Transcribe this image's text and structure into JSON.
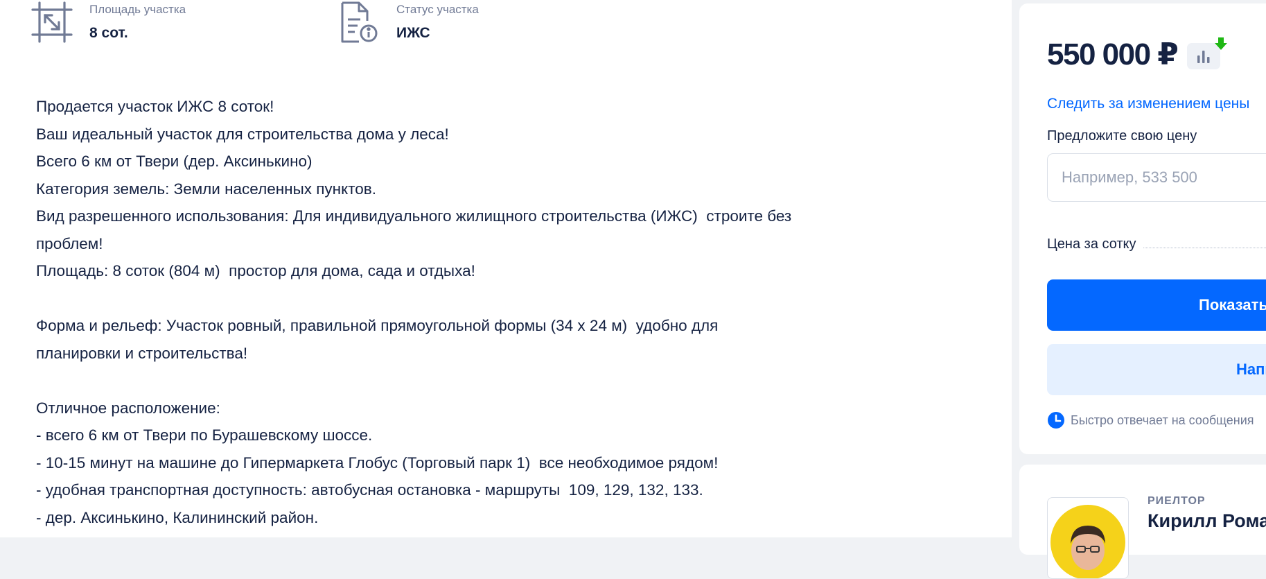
{
  "facts": [
    {
      "label": "Площадь участка",
      "value": "8 сот.",
      "icon": "resize-arrow-icon"
    },
    {
      "label": "Статус участка",
      "value": "ИЖС",
      "icon": "document-info-icon"
    }
  ],
  "description": "Продается участок ИЖС 8 соток!\nВаш идеальный участок для строительства дома у леса!\nВсего 6 км от Твери (дер. Аксинькино)\nКатегория земель: Земли населенных пунктов.\nВид разрешенного использования: Для индивидуального жилищного строительства (ИЖС)  строите без\nпроблем!\nПлощадь: 8 соток (804 м)  простор для дома, сада и отдыха!\n\nФорма и рельеф: Участок ровный, правильной прямоугольной формы (34 x 24 м)  удобно для\nпланировки и строительства!\n\nОтличное расположение:\n- всего 6 км от Твери по Бурашевскому шоссе.\n- 10-15 минут на машине до Гипермаркета Глобус (Торговый парк 1)  все необходимое рядом!\n- удобная транспортная доступность: автобусная остановка - маршруты  109, 129, 132, 133.\n- дер. Аксинькино, Калининский район.",
  "offer": {
    "price": "550 000 ₽",
    "price_history_icon": "bar-chart-icon",
    "price_drop_icon": "arrow-down-icon",
    "follow_link": "Следить за изменением цены",
    "suggest_label": "Предложите свою цену",
    "suggest_placeholder": "Например, 533 500",
    "per_unit_label": "Цена за сотку",
    "primary_button": "Показать",
    "secondary_button": "Написать",
    "reply_text": "Быстро отвечает на сообщения",
    "reply_icon": "clock-icon"
  },
  "agent": {
    "role": "РИЕЛТОР",
    "name": "Кирилл Романов"
  },
  "colors": {
    "accent": "#0468ff",
    "text": "#152242",
    "muted": "#707a95",
    "price_drop": "#1fb814",
    "page_bg": "#f0f2f5"
  }
}
